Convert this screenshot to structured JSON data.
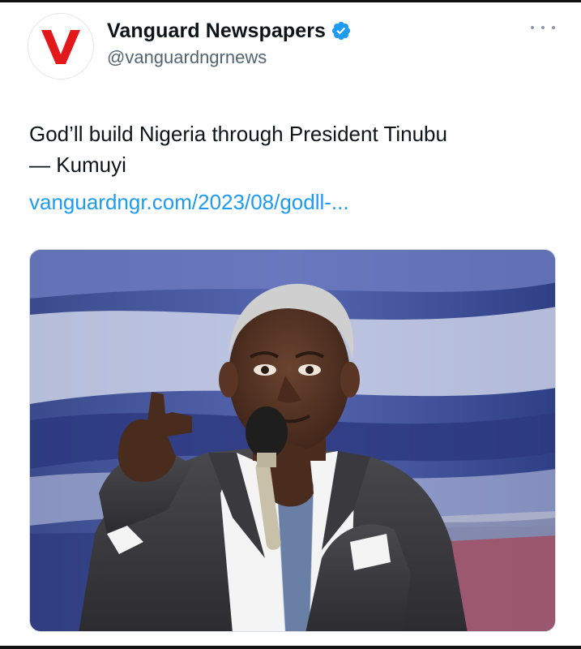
{
  "account": {
    "display_name": "Vanguard Newspapers",
    "handle": "@vanguardngrnews",
    "verified": true,
    "avatar_icon": "vanguard-logo-icon",
    "avatar_letter": "V"
  },
  "tweet": {
    "text_line1": "God’ll build Nigeria through President Tinubu",
    "text_line2": "— Kumuyi",
    "link_text": "vanguardngr.com/2023/08/godll-..."
  },
  "media": {
    "kind": "photo",
    "subject": "speaker-pointing-with-microphone-icon"
  },
  "colors": {
    "link": "#1d9bf0",
    "verified": "#1d9bf0",
    "logo_red": "#e3181a",
    "secondary_text": "#536471"
  }
}
